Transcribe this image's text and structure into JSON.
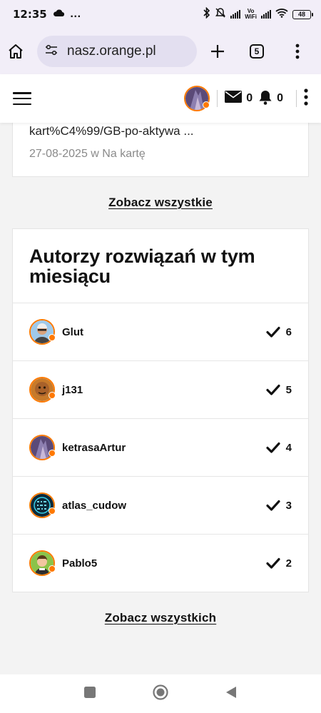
{
  "status_bar": {
    "time": "12:35",
    "extra": "…",
    "vowifi": "Vo\nWiFi",
    "battery": "48"
  },
  "browser": {
    "url": "nasz.orange.pl",
    "tab_count": "5"
  },
  "site_header": {
    "messages_count": "0",
    "notifications_count": "0"
  },
  "previous_card": {
    "snippet": "kart%C4%99/GB-po-aktywa ...",
    "meta": "27-08-2025 w Na kartę"
  },
  "see_all_top": "Zobacz wszystkie",
  "authors_section": {
    "title": "Autorzy rozwiązań w tym miesiącu",
    "rows": [
      {
        "name": "Glut",
        "count": "6"
      },
      {
        "name": "j131",
        "count": "5"
      },
      {
        "name": "ketrasaArtur",
        "count": "4"
      },
      {
        "name": "atlas_cudow",
        "count": "3"
      },
      {
        "name": "Pablo5",
        "count": "2"
      }
    ]
  },
  "see_all_bottom": "Zobacz wszystkich",
  "colors": {
    "accent": "#ff7900",
    "browser_bg": "#f2eef8",
    "page_bg": "#f3f3f3"
  }
}
